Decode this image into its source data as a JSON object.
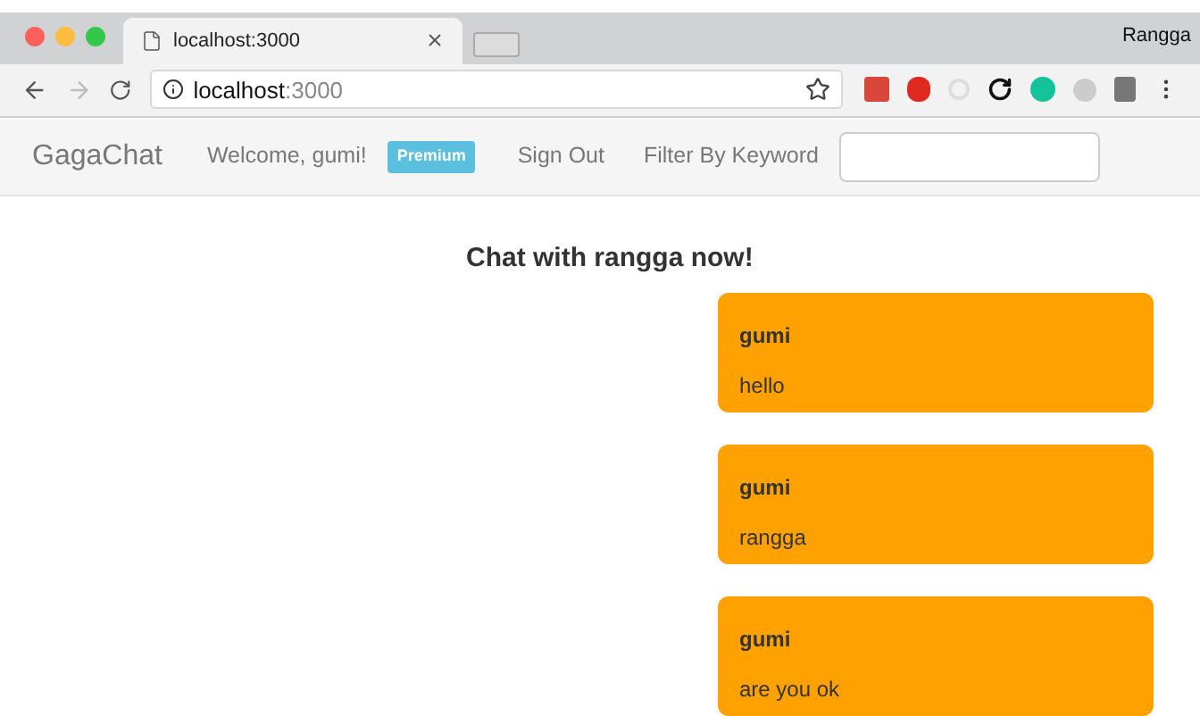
{
  "browser": {
    "tab_title": "localhost:3000",
    "profile": "Rangga",
    "url_host": "localhost",
    "url_port": ":3000"
  },
  "navbar": {
    "brand": "GagaChat",
    "welcome": "Welcome, gumi!",
    "badge": "Premium",
    "sign_out": "Sign Out",
    "filter_label": "Filter By Keyword"
  },
  "chat": {
    "title": "Chat with rangga now!",
    "messages": [
      {
        "sender": "gumi",
        "text": "hello"
      },
      {
        "sender": "gumi",
        "text": "rangga"
      },
      {
        "sender": "gumi",
        "text": "are you ok"
      }
    ]
  }
}
